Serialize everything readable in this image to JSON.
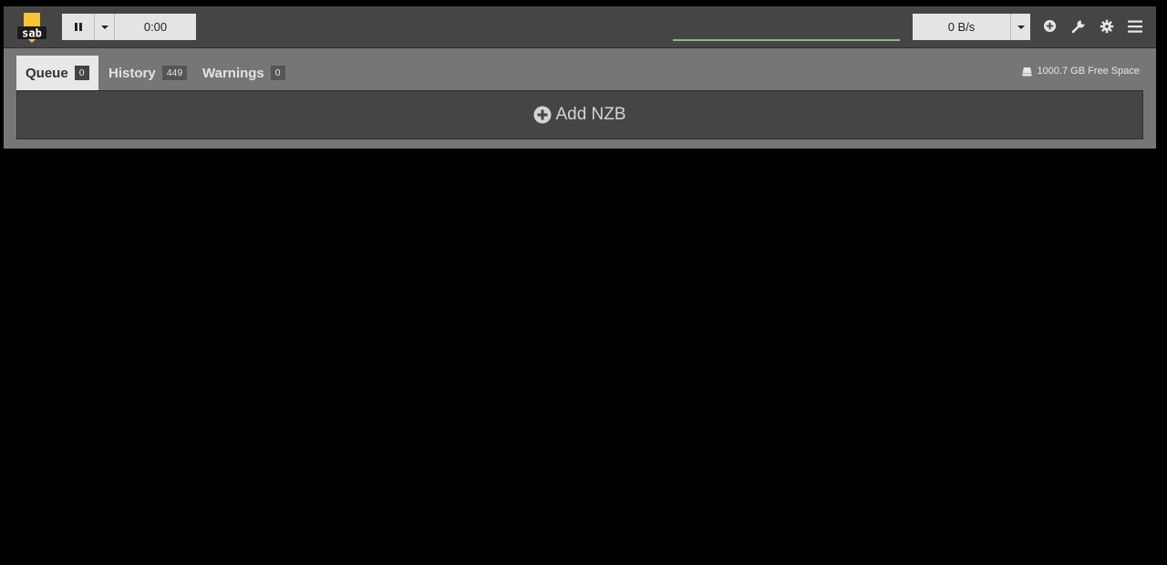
{
  "app": {
    "logo_text": "sab"
  },
  "toolbar": {
    "timer": "0:00",
    "speed": "0 B/s"
  },
  "icons": {
    "pause": "pause-icon",
    "add": "plus-circle-icon",
    "tools": "wrench-icon",
    "settings": "gear-icon",
    "menu": "hamburger-icon",
    "disk": "hdd-icon"
  },
  "tabs": [
    {
      "label": "Queue",
      "count": "0",
      "active": true
    },
    {
      "label": "History",
      "count": "449",
      "active": false
    },
    {
      "label": "Warnings",
      "count": "0",
      "active": false
    }
  ],
  "status": {
    "free_space": "1000.7 GB Free Space"
  },
  "queue": {
    "add_label": "Add NZB"
  },
  "colors": {
    "logo_yellow": "#f7c531",
    "background": "#000000",
    "navbar": "#454545",
    "tabs_bar": "#767676"
  }
}
